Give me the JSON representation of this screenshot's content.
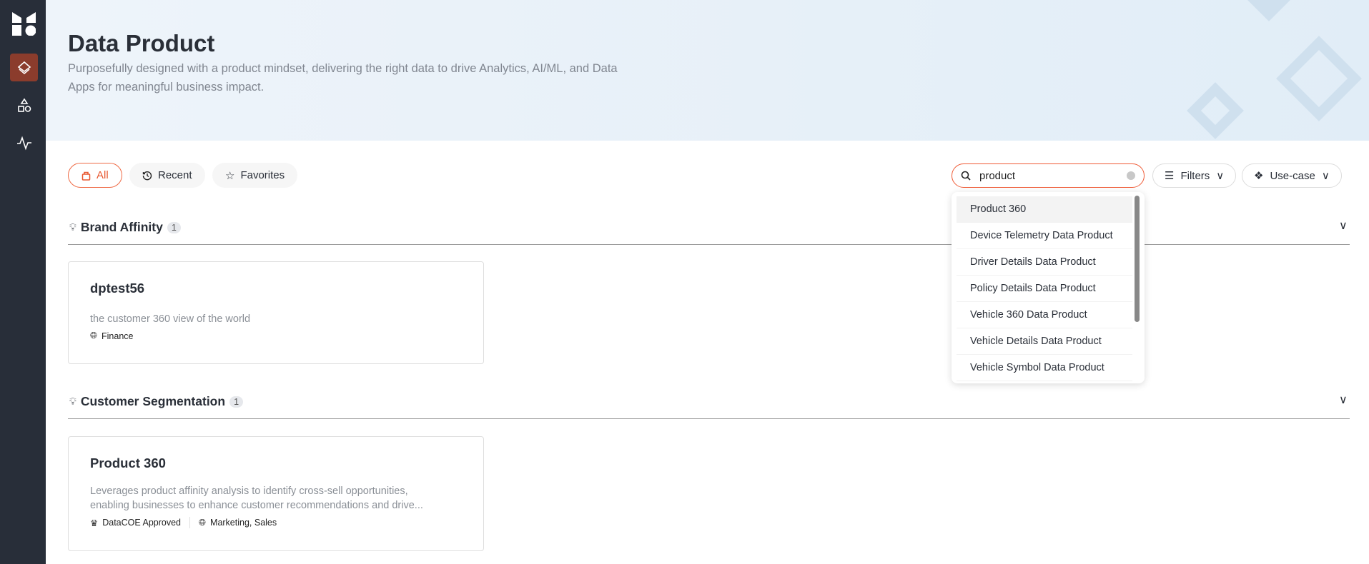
{
  "sidebar": {
    "items": [
      {
        "name": "data-products",
        "icon": "layers-icon",
        "active": true
      },
      {
        "name": "shapes",
        "icon": "shapes-icon"
      },
      {
        "name": "activity",
        "icon": "activity-icon"
      }
    ]
  },
  "header": {
    "title": "Data Product",
    "subtitle": "Purposefully designed with a product mindset, delivering the right data to drive Analytics, AI/ML, and Data Apps for meaningful business impact."
  },
  "tabs": [
    {
      "label": "All",
      "active": true
    },
    {
      "label": "Recent"
    },
    {
      "label": "Favorites"
    }
  ],
  "search": {
    "value": "product"
  },
  "filters_label": "Filters",
  "usecase_label": "Use-case",
  "sections": [
    {
      "title": "Brand Affinity",
      "count": "1",
      "cards": [
        {
          "title": "dptest56",
          "description": "the customer 360 view of the world",
          "domain": "Finance"
        }
      ]
    },
    {
      "title": "Customer Segmentation",
      "count": "1",
      "cards": [
        {
          "title": "Product 360",
          "description": "Leverages product affinity analysis to identify cross-sell opportunities, enabling businesses to enhance customer recommendations and drive...",
          "badge": "DataCOE Approved",
          "domain": "Marketing, Sales"
        }
      ]
    }
  ],
  "suggestions": [
    "Product 360",
    "Device Telemetry Data Product",
    "Driver Details Data Product",
    "Policy Details Data Product",
    "Vehicle 360 Data Product",
    "Vehicle Details Data Product",
    "Vehicle Symbol Data Product"
  ],
  "colors": {
    "accent": "#ef5a35",
    "sidebar": "#282e39",
    "active_nav": "#8b3c2c"
  }
}
